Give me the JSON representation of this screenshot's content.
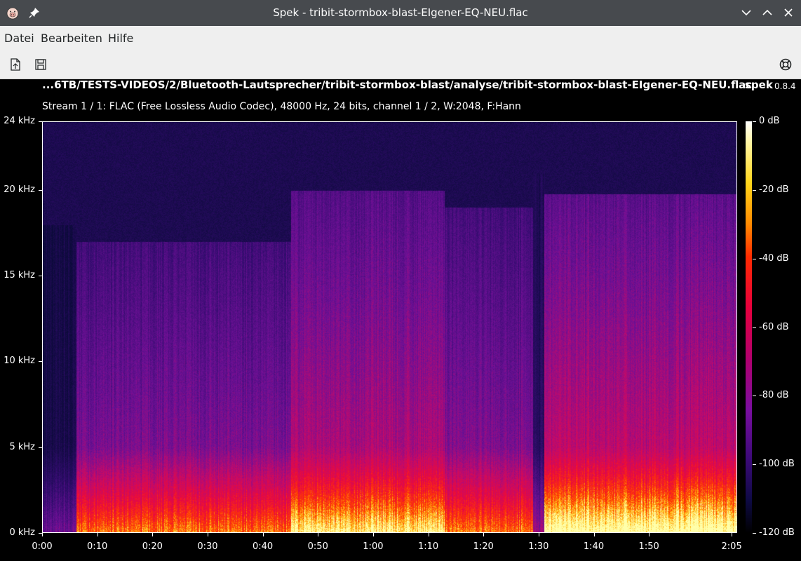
{
  "window": {
    "title": "Spek - tribit-stormbox-blast-EIgener-EQ-NEU.flac",
    "app_icon": "spek-pig-icon",
    "pin_icon": "pin-icon",
    "controls": [
      "minimize-icon",
      "maximize-icon",
      "close-icon"
    ]
  },
  "menubar": {
    "items": [
      "Datei",
      "Bearbeiten",
      "Hilfe"
    ]
  },
  "toolbar": {
    "open_icon": "open-file-icon",
    "save_icon": "save-icon",
    "help_icon": "lifebuoy-icon"
  },
  "content": {
    "file_path": "...6TB/TESTS-VIDEOS/2/Bluetooth-Lautsprecher/tribit-stormbox-blast/analyse/tribit-stormbox-blast-EIgener-EQ-NEU.flac",
    "app_name": "spek",
    "app_version": "0.8.4",
    "stream_info": "Stream 1 / 1: FLAC (Free Lossless Audio Codec), 48000 Hz, 24 bits, channel 1 / 2, W:2048, F:Hann"
  },
  "chart_data": {
    "type": "heatmap",
    "title": "",
    "y_axis": {
      "unit": "kHz",
      "range": [
        0,
        24
      ],
      "ticks": [
        "24 kHz",
        "20 kHz",
        "15 kHz",
        "10 kHz",
        "5 kHz",
        "0 kHz"
      ],
      "tick_values": [
        24,
        20,
        15,
        10,
        5,
        0
      ]
    },
    "x_axis": {
      "unit": "time",
      "range_seconds": [
        0,
        126
      ],
      "ticks": [
        "0:00",
        "0:10",
        "0:20",
        "0:30",
        "0:40",
        "0:50",
        "1:00",
        "1:10",
        "1:20",
        "1:30",
        "1:40",
        "1:50",
        "2:05"
      ],
      "tick_seconds": [
        0,
        10,
        20,
        30,
        40,
        50,
        60,
        70,
        80,
        90,
        100,
        110,
        125
      ]
    },
    "colorbar": {
      "unit": "dB",
      "range": [
        -120,
        0
      ],
      "ticks": [
        "0 dB",
        "-20 dB",
        "-40 dB",
        "-60 dB",
        "-80 dB",
        "-100 dB",
        "-120 dB"
      ],
      "tick_values": [
        0,
        -20,
        -40,
        -60,
        -80,
        -100,
        -120
      ]
    },
    "colors": {
      "loud": "#ffff80",
      "mid": "#ff1a1a",
      "quiet": "#7a0ea0",
      "silent": "#0c0a3a"
    },
    "energy_profile": [
      {
        "from_s": 0,
        "to_s": 6,
        "cutoff_khz": 18,
        "level": 0.1
      },
      {
        "from_s": 6,
        "to_s": 45,
        "cutoff_khz": 17,
        "level": 0.55
      },
      {
        "from_s": 45,
        "to_s": 73,
        "cutoff_khz": 20,
        "level": 0.65
      },
      {
        "from_s": 73,
        "to_s": 89,
        "cutoff_khz": 19,
        "level": 0.55
      },
      {
        "from_s": 89,
        "to_s": 91,
        "cutoff_khz": 21,
        "level": 0.2
      },
      {
        "from_s": 91,
        "to_s": 125,
        "cutoff_khz": 19.8,
        "level": 0.7
      }
    ]
  }
}
